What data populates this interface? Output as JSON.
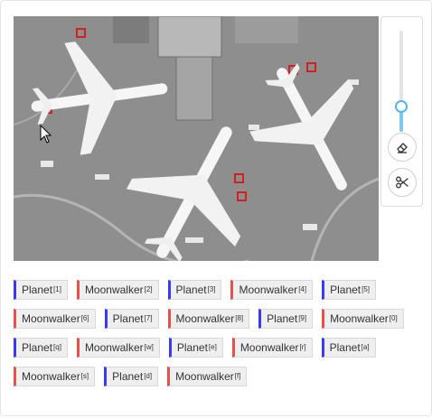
{
  "colors": {
    "planet": "#3a3af0",
    "moonwalker": "#e85050",
    "accent": "#52b4ea"
  },
  "zoom_slider": {
    "level": 0.25
  },
  "tools": [
    {
      "name": "eraser-icon"
    },
    {
      "name": "scissors-icon"
    }
  ],
  "tags": [
    [
      {
        "label": "Planet",
        "key": "[1]",
        "kind": "planet"
      },
      {
        "label": "Moonwalker",
        "key": "[2]",
        "kind": "moonwalker"
      },
      {
        "label": "Planet",
        "key": "[3]",
        "kind": "planet"
      },
      {
        "label": "Moonwalker",
        "key": "[4]",
        "kind": "moonwalker"
      },
      {
        "label": "Planet",
        "key": "[5]",
        "kind": "planet"
      }
    ],
    [
      {
        "label": "Moonwalker",
        "key": "[6]",
        "kind": "moonwalker"
      },
      {
        "label": "Planet",
        "key": "[7]",
        "kind": "planet"
      },
      {
        "label": "Moonwalker",
        "key": "[8]",
        "kind": "moonwalker"
      },
      {
        "label": "Planet",
        "key": "[9]",
        "kind": "planet"
      },
      {
        "label": "Moonwalker",
        "key": "[0]",
        "kind": "moonwalker"
      }
    ],
    [
      {
        "label": "Planet",
        "key": "[q]",
        "kind": "planet"
      },
      {
        "label": "Moonwalker",
        "key": "[w]",
        "kind": "moonwalker"
      },
      {
        "label": "Planet",
        "key": "[e]",
        "kind": "planet"
      },
      {
        "label": "Moonwalker",
        "key": "[r]",
        "kind": "moonwalker"
      },
      {
        "label": "Planet",
        "key": "[a]",
        "kind": "planet"
      }
    ],
    [
      {
        "label": "Moonwalker",
        "key": "[s]",
        "kind": "moonwalker"
      },
      {
        "label": "Planet",
        "key": "[d]",
        "kind": "planet"
      },
      {
        "label": "Moonwalker",
        "key": "[f]",
        "kind": "moonwalker"
      }
    ]
  ]
}
